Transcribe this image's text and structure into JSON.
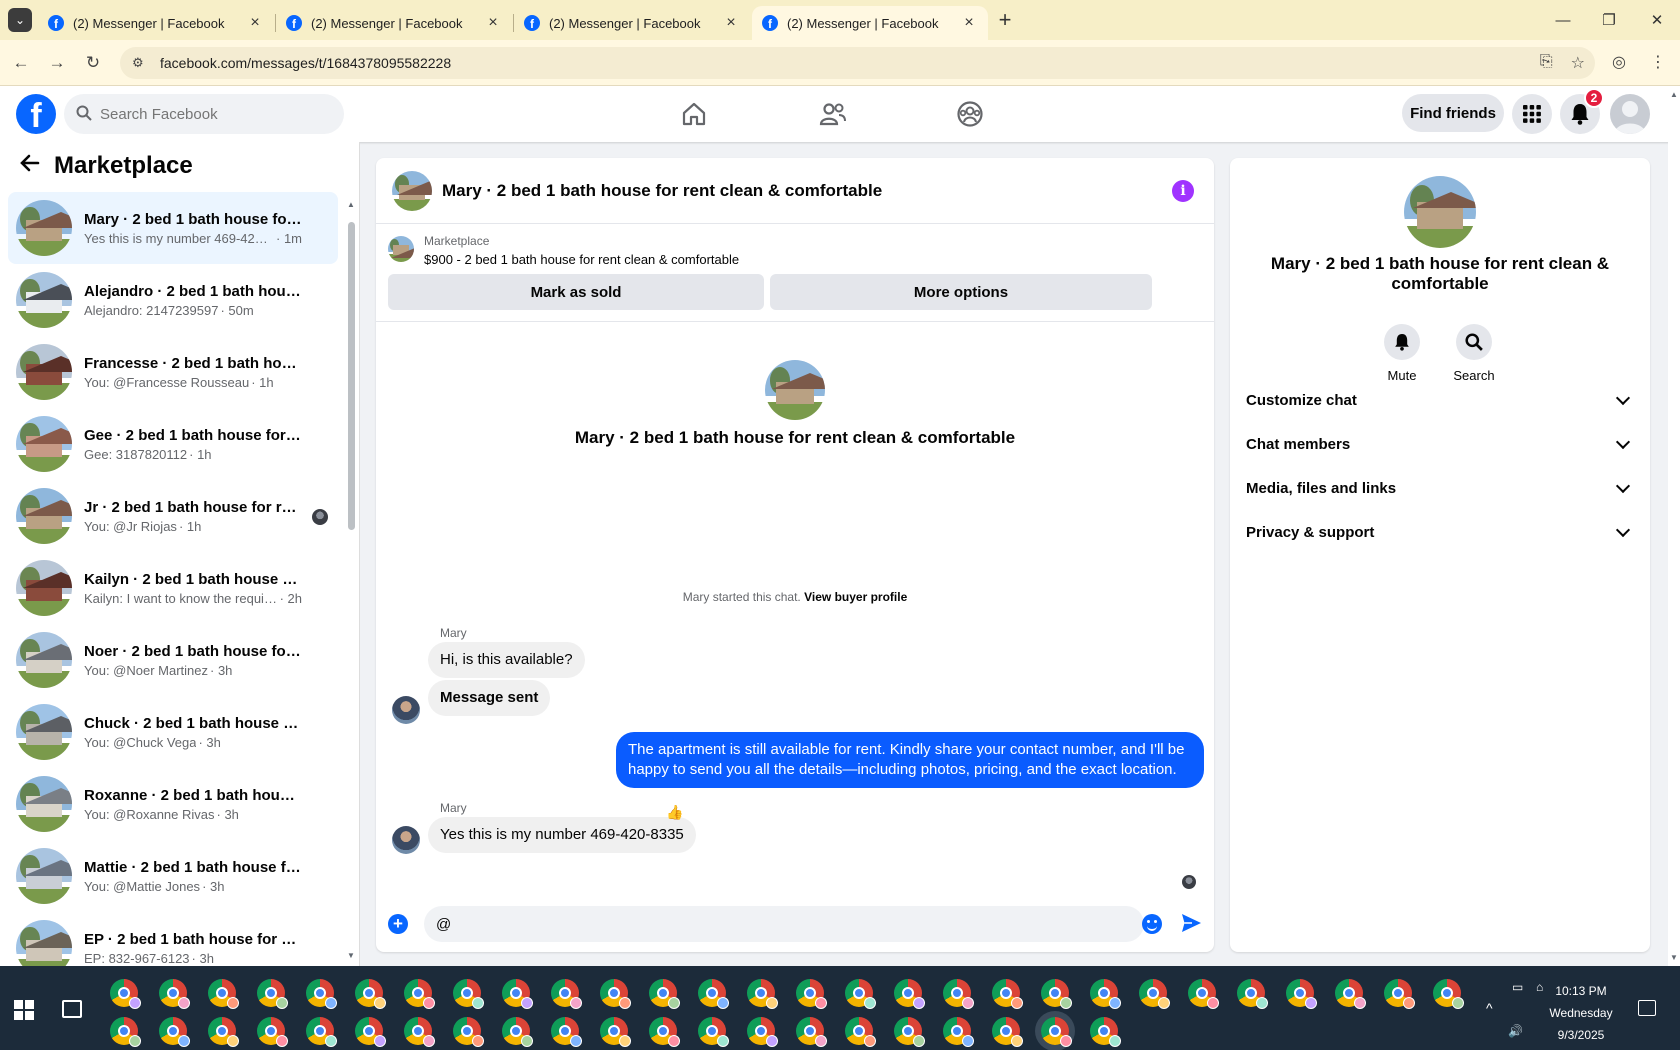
{
  "browser": {
    "tabs": [
      {
        "title": "(2) Messenger | Facebook",
        "active": false
      },
      {
        "title": "(2) Messenger | Facebook",
        "active": false
      },
      {
        "title": "(2) Messenger | Facebook",
        "active": false
      },
      {
        "title": "(2) Messenger | Facebook",
        "active": true
      }
    ],
    "new_tab": "+",
    "url": "facebook.com/messages/t/1684378095582228"
  },
  "header": {
    "search_placeholder": "Search Facebook",
    "find_friends": "Find friends",
    "notification_count": "2"
  },
  "sidebar": {
    "title": "Marketplace",
    "conversations": [
      {
        "name": "Mary · 2 bed 1 bath house for re...",
        "snippet": "Yes this is my number 469-420-83...",
        "ago": "· 1m",
        "active": true,
        "palette": [
          "#8fb7dc",
          "#b9a183",
          "#7c5a4a"
        ]
      },
      {
        "name": "Alejandro · 2 bed 1 bath house f...",
        "snippet": "Alejandro: 2147239597",
        "ago": "· 50m",
        "active": false,
        "palette": [
          "#a9c4e0",
          "#e9ecef",
          "#4a4f57"
        ]
      },
      {
        "name": "Francesse · 2 bed 1 bath house f...",
        "snippet": "You: @Francesse Rousseau",
        "ago": "· 1h",
        "active": false,
        "palette": [
          "#b8c6d6",
          "#8a4b3c",
          "#5a3028"
        ]
      },
      {
        "name": "Gee · 2 bed 1 bath house for ren...",
        "snippet": "Gee: 3187820112",
        "ago": "· 1h",
        "active": false,
        "palette": [
          "#9fc3e6",
          "#c79a86",
          "#8a5a4a"
        ]
      },
      {
        "name": "Jr · 2 bed 1 bath house for ren...",
        "snippet": "You: @Jr Riojas",
        "ago": "· 1h",
        "active": false,
        "seen": true,
        "palette": [
          "#8fb7dc",
          "#b9a183",
          "#7c5a4a"
        ]
      },
      {
        "name": "Kailyn · 2 bed 1 bath house for r...",
        "snippet": "Kailyn: I want to know the require...",
        "ago": "· 2h",
        "active": false,
        "palette": [
          "#b8c6d6",
          "#8a4b3c",
          "#5a3028"
        ]
      },
      {
        "name": "Noer · 2 bed 1 bath house for re...",
        "snippet": "You: @Noer Martinez",
        "ago": "· 3h",
        "active": false,
        "palette": [
          "#a9c4e0",
          "#d5d0c6",
          "#6a6e75"
        ]
      },
      {
        "name": "Chuck · 2 bed 1 bath house for r...",
        "snippet": "You: @Chuck Vega",
        "ago": "· 3h",
        "active": false,
        "palette": [
          "#9fc3e6",
          "#b7b3aa",
          "#5c5f64"
        ]
      },
      {
        "name": "Roxanne · 2 bed 1 bath house fo...",
        "snippet": "You: @Roxanne Rivas",
        "ago": "· 3h",
        "active": false,
        "palette": [
          "#8fb7dc",
          "#d9d4c9",
          "#7a7f86"
        ]
      },
      {
        "name": "Mattie · 2 bed 1 bath house for r...",
        "snippet": "You: @Mattie Jones",
        "ago": "· 3h",
        "active": false,
        "palette": [
          "#a9c4e0",
          "#c9ced6",
          "#6a7482"
        ]
      },
      {
        "name": "EP · 2 bed 1 bath house for rent ...",
        "snippet": "EP: 832-967-6123",
        "ago": "· 3h",
        "active": false,
        "palette": [
          "#9fc3e6",
          "#cfc6b8",
          "#6b6358"
        ]
      }
    ]
  },
  "chat": {
    "title": "Mary · 2 bed 1 bath house for rent clean & comfortable",
    "marketplace_label": "Marketplace",
    "listing": "$900 - 2 bed 1 bath house for rent clean & comfortable",
    "mark_sold": "Mark as sold",
    "more_options": "More options",
    "intro_name": "Mary · 2 bed 1 bath house for rent clean & comfortable",
    "started_text": "Mary started this chat.",
    "view_buyer": "View buyer profile",
    "sender1": "Mary",
    "msg1": "Hi, is this available?",
    "msg2": "Message sent",
    "msg3": "The apartment is still available for rent. Kindly share your contact number, and I'll be happy to send you all the details—including photos, pricing, and the exact location.",
    "sender2": "Mary",
    "msg4": "Yes this is my number 469-420-8335",
    "reaction": "👍",
    "composer_value": "@"
  },
  "panel": {
    "name": "Mary · 2 bed 1 bath house for rent clean & comfortable",
    "mute": "Mute",
    "search": "Search",
    "sections": [
      "Customize chat",
      "Chat members",
      "Media, files and links",
      "Privacy & support"
    ]
  },
  "taskbar": {
    "time": "10:13 PM",
    "day": "Wednesday",
    "date": "9/3/2025",
    "profile_colors": [
      "#c3a2ff",
      "#f4a3c8",
      "#ff9a7a",
      "#a7d3a0",
      "#7fb4ff",
      "#ffd27a",
      "#ff8fa3",
      "#9ee6d1"
    ]
  },
  "colors": {
    "brand": "#0866ff",
    "outgoing": "#0a5cff",
    "info": "#a033ff",
    "badge": "#e41e3f"
  }
}
